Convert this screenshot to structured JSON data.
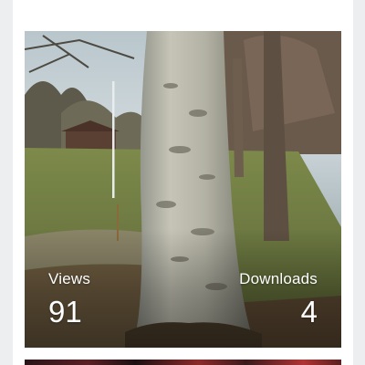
{
  "card": {
    "image_alt": "Large plane tree trunk beside a path in a park near a river",
    "stats": [
      {
        "label": "Views",
        "value": "91"
      },
      {
        "label": "Downloads",
        "value": "4"
      }
    ]
  }
}
